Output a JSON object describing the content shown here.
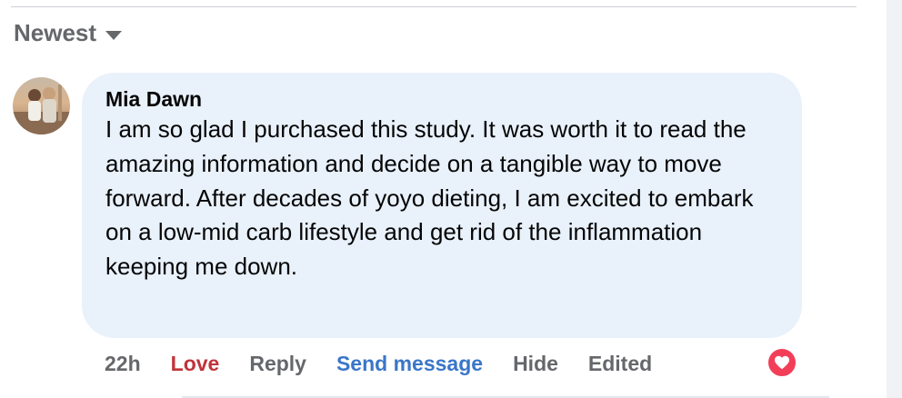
{
  "sort": {
    "label": "Newest"
  },
  "comment": {
    "author": "Mia Dawn",
    "text": "I am so glad I purchased this study. It was worth it to read the amazing information and decide on a tangible way to move forward. After decades of yoyo dieting, I am excited to embark on a low-mid carb lifestyle and get rid of the inflammation keeping me down."
  },
  "actions": {
    "time": "22h",
    "love": "Love",
    "reply": "Reply",
    "send_message": "Send message",
    "hide": "Hide",
    "edited": "Edited"
  },
  "reaction": {
    "icon": "heart-icon",
    "color": "#f33e58"
  },
  "colors": {
    "bubble": "#e9f1fb",
    "love": "#c0343b",
    "link": "#3a76c8",
    "muted": "#65676b"
  }
}
